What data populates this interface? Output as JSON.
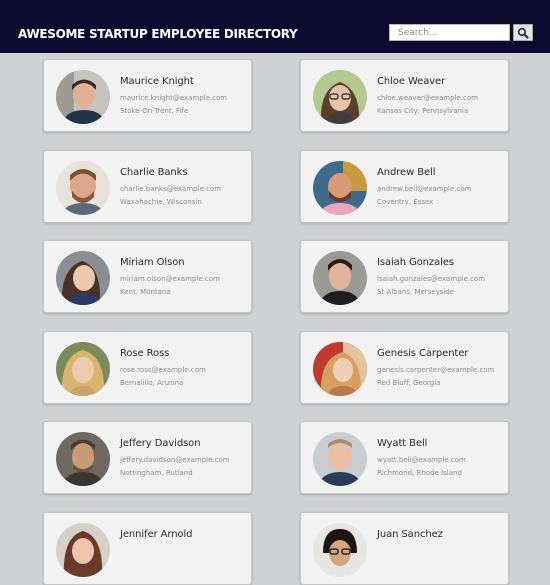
{
  "header": {
    "title": "AWESOME STARTUP EMPLOYEE DIRECTORY",
    "search_placeholder": "Search...",
    "search_icon": "magnifier-icon",
    "background": "#0c0a2e"
  },
  "employees": [
    {
      "name": "Maurice Knight",
      "email": "maurice.knight@example.com",
      "location": "Stoke-On-Trent, Fife"
    },
    {
      "name": "Chloe Weaver",
      "email": "chloe.weaver@example.com",
      "location": "Kansas City, Pennsylvania"
    },
    {
      "name": "Charlie Banks",
      "email": "charlie.banks@example.com",
      "location": "Waxahachie, Wisconsin"
    },
    {
      "name": "Andrew Bell",
      "email": "andrew.bell@example.com",
      "location": "Coventry, Essex"
    },
    {
      "name": "Miriam Olson",
      "email": "miriam.olson@example.com",
      "location": "Kent, Montana"
    },
    {
      "name": "Isaiah Gonzales",
      "email": "isaiah.gonzales@example.com",
      "location": "St Albans, Merseyside"
    },
    {
      "name": "Rose Ross",
      "email": "rose.ross@example.com",
      "location": "Bernalillo, Arizona"
    },
    {
      "name": "Genesis Carpenter",
      "email": "genesis.carpenter@example.com",
      "location": "Red Bluff, Georgia"
    },
    {
      "name": "Jeffery Davidson",
      "email": "jeffery.davidson@example.com",
      "location": "Nottingham, Rutland"
    },
    {
      "name": "Wyatt Bell",
      "email": "wyatt.bell@example.com",
      "location": "Richmond, Rhode Island"
    },
    {
      "name": "Jennifer Arnold",
      "email": "",
      "location": ""
    },
    {
      "name": "Juan Sanchez",
      "email": "",
      "location": ""
    }
  ]
}
